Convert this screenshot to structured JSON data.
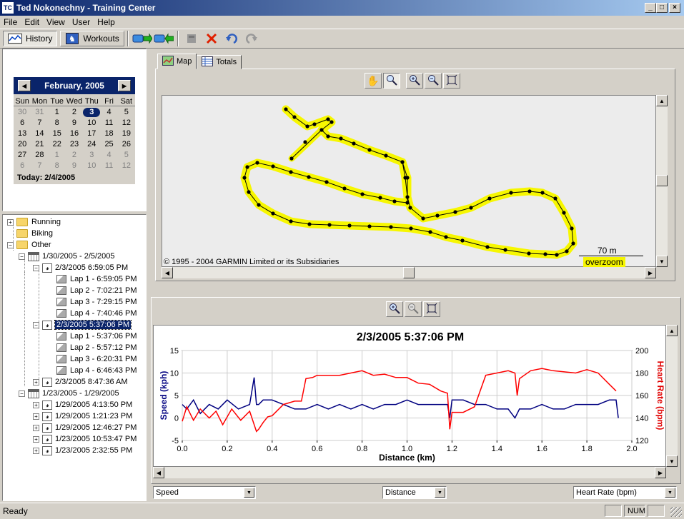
{
  "window": {
    "title": "Ted Nokonechny - Training Center",
    "icon_text": "TC"
  },
  "menu": [
    "File",
    "Edit",
    "View",
    "User",
    "Help"
  ],
  "toolbar": {
    "history_label": "History",
    "workouts_label": "Workouts"
  },
  "calendar": {
    "month_label": "February, 2005",
    "weekdays": [
      "Sun",
      "Mon",
      "Tue",
      "Wed",
      "Thu",
      "Fri",
      "Sat"
    ],
    "days": [
      [
        "30",
        "31",
        "1",
        "2",
        "3",
        "4",
        "5"
      ],
      [
        "6",
        "7",
        "8",
        "9",
        "10",
        "11",
        "12"
      ],
      [
        "13",
        "14",
        "15",
        "16",
        "17",
        "18",
        "19"
      ],
      [
        "20",
        "21",
        "22",
        "23",
        "24",
        "25",
        "26"
      ],
      [
        "27",
        "28",
        "1",
        "2",
        "3",
        "4",
        "5"
      ],
      [
        "6",
        "7",
        "8",
        "9",
        "10",
        "11",
        "12"
      ]
    ],
    "selected_day": "3",
    "today_label": "Today: 2/4/2005"
  },
  "tree": [
    {
      "label": "Running",
      "kind": "folder",
      "level": 0,
      "exp": "+"
    },
    {
      "label": "Biking",
      "kind": "folder",
      "level": 0,
      "exp": ""
    },
    {
      "label": "Other",
      "kind": "folder",
      "level": 0,
      "exp": "-"
    },
    {
      "label": "1/30/2005 - 2/5/2005",
      "kind": "week",
      "level": 1,
      "exp": "-"
    },
    {
      "label": "2/3/2005 6:59:05 PM",
      "kind": "run",
      "level": 2,
      "exp": "-"
    },
    {
      "label": "Lap 1 - 6:59:05 PM",
      "kind": "lap",
      "level": 3,
      "exp": ""
    },
    {
      "label": "Lap 2 - 7:02:21 PM",
      "kind": "lap",
      "level": 3,
      "exp": ""
    },
    {
      "label": "Lap 3 - 7:29:15 PM",
      "kind": "lap",
      "level": 3,
      "exp": ""
    },
    {
      "label": "Lap 4 - 7:40:46 PM",
      "kind": "lap",
      "level": 3,
      "exp": ""
    },
    {
      "label": "2/3/2005 5:37:06 PM",
      "kind": "run",
      "level": 2,
      "exp": "-",
      "selected": true
    },
    {
      "label": "Lap 1 - 5:37:06 PM",
      "kind": "lap",
      "level": 3,
      "exp": ""
    },
    {
      "label": "Lap 2 - 5:57:12 PM",
      "kind": "lap",
      "level": 3,
      "exp": ""
    },
    {
      "label": "Lap 3 - 6:20:31 PM",
      "kind": "lap",
      "level": 3,
      "exp": ""
    },
    {
      "label": "Lap 4 - 6:46:43 PM",
      "kind": "lap",
      "level": 3,
      "exp": ""
    },
    {
      "label": "2/3/2005 8:47:36 AM",
      "kind": "run",
      "level": 2,
      "exp": "+"
    },
    {
      "label": "1/23/2005 - 1/29/2005",
      "kind": "week",
      "level": 1,
      "exp": "-"
    },
    {
      "label": "1/29/2005 4:13:50 PM",
      "kind": "run",
      "level": 2,
      "exp": "+"
    },
    {
      "label": "1/29/2005 1:21:23 PM",
      "kind": "run",
      "level": 2,
      "exp": "+"
    },
    {
      "label": "1/29/2005 12:46:27 PM",
      "kind": "run",
      "level": 2,
      "exp": "+"
    },
    {
      "label": "1/23/2005 10:53:47 PM",
      "kind": "run",
      "level": 2,
      "exp": "+"
    },
    {
      "label": "1/23/2005 2:32:55 PM",
      "kind": "run",
      "level": 2,
      "exp": "+"
    }
  ],
  "tabs": {
    "map_label": "Map",
    "totals_label": "Totals"
  },
  "map": {
    "copyright": "© 1995 - 2004 GARMIN Limited or its Subsidiaries",
    "scale_label": "70 m",
    "overzoom_label": "overzoom",
    "track_color": "#f7f700"
  },
  "chart_data": {
    "type": "line",
    "title": "2/3/2005 5:37:06 PM",
    "xlabel": "Distance (km)",
    "ylabel": "Speed (kph)",
    "y2label": "Heart Rate (bpm)",
    "xlim": [
      0.0,
      2.0
    ],
    "ylim": [
      -5,
      15
    ],
    "y2lim": [
      120,
      200
    ],
    "xticks": [
      "0.0",
      "0.2",
      "0.4",
      "0.6",
      "0.8",
      "1.0",
      "1.2",
      "1.4",
      "1.6",
      "1.8",
      "2.0"
    ],
    "yticks": [
      "15",
      "10",
      "5",
      "0",
      "-5"
    ],
    "y2ticks": [
      "200",
      "180",
      "160",
      "140",
      "120"
    ],
    "grid": true,
    "series": [
      {
        "name": "Speed (kph)",
        "axis": "left",
        "color": "#000080",
        "x": [
          0.0,
          0.02,
          0.05,
          0.08,
          0.12,
          0.16,
          0.2,
          0.25,
          0.3,
          0.32,
          0.33,
          0.34,
          0.36,
          0.4,
          0.45,
          0.5,
          0.55,
          0.6,
          0.65,
          0.7,
          0.75,
          0.8,
          0.85,
          0.9,
          0.95,
          1.0,
          1.05,
          1.1,
          1.15,
          1.18,
          1.19,
          1.2,
          1.25,
          1.3,
          1.35,
          1.4,
          1.45,
          1.48,
          1.5,
          1.55,
          1.6,
          1.65,
          1.7,
          1.75,
          1.8,
          1.85,
          1.9,
          1.93,
          1.94
        ],
        "values": [
          3,
          2,
          4,
          1,
          3,
          2,
          4,
          2,
          3,
          9,
          3,
          3,
          4,
          4,
          3,
          2,
          2,
          3,
          2,
          3,
          2,
          3,
          2,
          3,
          3,
          4,
          3,
          3,
          3,
          3,
          0,
          4,
          4,
          3,
          3,
          2,
          2,
          0,
          2,
          2,
          3,
          2,
          2,
          3,
          3,
          3,
          4,
          4,
          0
        ]
      },
      {
        "name": "Heart Rate (bpm)",
        "axis": "right",
        "color": "#ff0000",
        "x": [
          0.0,
          0.02,
          0.05,
          0.08,
          0.12,
          0.15,
          0.18,
          0.22,
          0.26,
          0.3,
          0.33,
          0.34,
          0.36,
          0.38,
          0.4,
          0.45,
          0.5,
          0.53,
          0.55,
          0.58,
          0.6,
          0.7,
          0.75,
          0.8,
          0.85,
          0.9,
          0.95,
          1.0,
          1.05,
          1.1,
          1.15,
          1.18,
          1.19,
          1.2,
          1.25,
          1.3,
          1.35,
          1.4,
          1.45,
          1.48,
          1.49,
          1.5,
          1.55,
          1.6,
          1.65,
          1.7,
          1.75,
          1.8,
          1.85,
          1.9,
          1.93
        ],
        "values": [
          137,
          150,
          138,
          148,
          140,
          146,
          134,
          148,
          138,
          146,
          128,
          130,
          136,
          141,
          142,
          152,
          155,
          155,
          175,
          176,
          178,
          178,
          180,
          182,
          178,
          179,
          176,
          176,
          171,
          170,
          164,
          162,
          130,
          145,
          145,
          150,
          178,
          180,
          182,
          180,
          160,
          175,
          182,
          184,
          182,
          181,
          180,
          183,
          180,
          170,
          164
        ]
      }
    ]
  },
  "combos": {
    "left": "Speed",
    "middle": "Distance",
    "right": "Heart Rate (bpm)"
  },
  "status": {
    "text": "Ready",
    "num": "NUM"
  }
}
